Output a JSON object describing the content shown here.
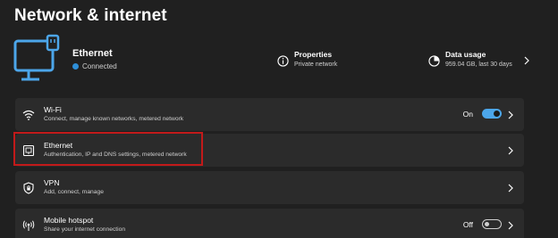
{
  "page": {
    "title": "Network & internet"
  },
  "hero": {
    "icon": "ethernet-computer-icon",
    "name": "Ethernet",
    "status": "Connected",
    "status_color": "#2e8fd8",
    "accent_color": "#4ca6ea",
    "properties": {
      "icon": "info-icon",
      "title": "Properties",
      "subtitle": "Private network"
    },
    "data_usage": {
      "icon": "pie-chart-icon",
      "title": "Data usage",
      "subtitle": "959.04 GB, last 30 days"
    }
  },
  "rows": [
    {
      "icon": "wifi-icon",
      "title": "Wi-Fi",
      "subtitle": "Connect, manage known networks, metered network",
      "toggle_label": "On",
      "toggle_on": true
    },
    {
      "icon": "ethernet-icon",
      "title": "Ethernet",
      "subtitle": "Authentication, IP and DNS settings, metered network",
      "highlighted": true,
      "highlight_color": "#c21a1a"
    },
    {
      "icon": "vpn-shield-icon",
      "title": "VPN",
      "subtitle": "Add, connect, manage"
    },
    {
      "icon": "mobile-hotspot-icon",
      "title": "Mobile hotspot",
      "subtitle": "Share your internet connection",
      "toggle_label": "Off",
      "toggle_on": false
    }
  ]
}
